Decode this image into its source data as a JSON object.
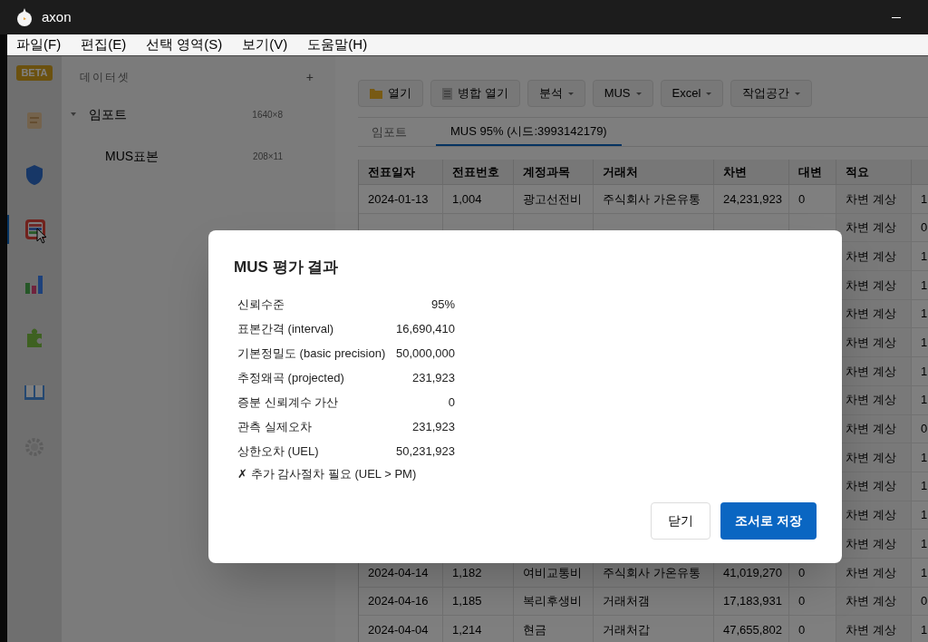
{
  "window": {
    "title": "axon"
  },
  "menu": [
    "파일(F)",
    "편집(E)",
    "선택 영역(S)",
    "보기(V)",
    "도움말(H)"
  ],
  "rail": {
    "badge": "BETA",
    "items": [
      {
        "kind": "scroll",
        "selected": false
      },
      {
        "kind": "shield",
        "selected": false
      },
      {
        "kind": "table",
        "selected": true
      },
      {
        "kind": "chart",
        "selected": false
      },
      {
        "kind": "puzzle",
        "selected": false
      },
      {
        "kind": "book",
        "selected": false
      },
      {
        "kind": "gear",
        "selected": false
      }
    ]
  },
  "datasets": {
    "title": "데이터셋",
    "add": "+",
    "items": [
      {
        "name": "임포트",
        "size": "1640×8",
        "expanded": true,
        "children": [
          {
            "name": "MUS표본",
            "size": "208×11"
          }
        ]
      }
    ]
  },
  "toolbar": [
    {
      "label": "열기",
      "kind": "folder"
    },
    {
      "label": "병합 열기",
      "kind": "doc"
    },
    {
      "label": "분석",
      "kind": "dropdown"
    },
    {
      "label": "MUS",
      "kind": "dropdown"
    },
    {
      "label": "Excel",
      "kind": "dropdown"
    },
    {
      "label": "작업공간",
      "kind": "dropdown"
    }
  ],
  "tabs": [
    {
      "label": "임포트",
      "selected": false
    },
    {
      "label": "MUS 95% (시드:3993142179)",
      "selected": true
    }
  ],
  "table": {
    "columns": [
      "전표일자",
      "전표번호",
      "계정과목",
      "거래처",
      "차변",
      "대변",
      "적요"
    ],
    "rows": [
      {
        "cells": [
          "2024-01-13",
          "1,004",
          "광고선전비",
          "주식회사 가온유통",
          "24,231,923",
          "0",
          "차변 계상",
          "1"
        ]
      },
      {
        "memo": "차변 계상",
        "col_8": "0"
      },
      {
        "memo": "차변 계상",
        "col_8": "1"
      },
      {
        "memo": "차변 계상",
        "col_8": "1"
      },
      {
        "memo": "차변 계상",
        "col_8": "1"
      },
      {
        "memo": "차변 계상",
        "col_8": "1"
      },
      {
        "memo": "차변 계상",
        "col_8": "1"
      },
      {
        "memo": "차변 계상",
        "col_8": "1"
      },
      {
        "memo": "차변 계상",
        "col_8": "0"
      },
      {
        "memo": "차변 계상",
        "col_8": "1"
      },
      {
        "memo": "차변 계상",
        "col_8": "1"
      },
      {
        "memo": "차변 계상",
        "col_8": "1"
      },
      {
        "memo": "차변 계상",
        "col_8": "1"
      },
      {
        "cells": [
          "2024-04-14",
          "1,182",
          "여비교통비",
          "주식회사 가온유통",
          "41,019,270",
          "0",
          "차변 계상",
          "1"
        ]
      },
      {
        "cells": [
          "2024-04-16",
          "1,185",
          "복리후생비",
          "거래처갬",
          "17,183,931",
          "0",
          "차변 계상",
          "0"
        ]
      },
      {
        "cells": [
          "2024-04-04",
          "1,214",
          "현금",
          "거래처갑",
          "47,655,802",
          "0",
          "차변 계상",
          "1"
        ]
      }
    ]
  },
  "dialog": {
    "title": "MUS 평가 결과",
    "results": [
      {
        "label": "신뢰수준",
        "value": "95%"
      },
      {
        "label": "표본간격 (interval)",
        "value": "16,690,410"
      },
      {
        "label": "기본정밀도 (basic precision)",
        "value": "50,000,000"
      },
      {
        "label": "추정왜곡 (projected)",
        "value": "231,923"
      },
      {
        "label": "증분 신뢰계수 가산",
        "value": "0"
      },
      {
        "label": "관측 실제오차",
        "value": "231,923"
      },
      {
        "label": "상한오차 (UEL)",
        "value": "50,231,923"
      }
    ],
    "note": "✗ 추가 감사절차 필요 (UEL > PM)",
    "buttons": [
      {
        "label": "닫기",
        "kind": "secondary"
      },
      {
        "label": "조서로 저장",
        "kind": "primary"
      }
    ]
  }
}
